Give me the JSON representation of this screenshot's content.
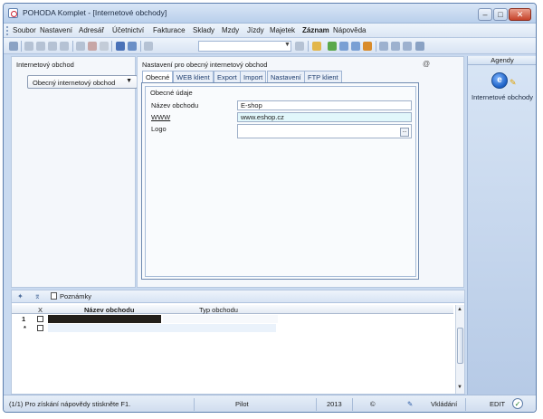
{
  "window": {
    "title": "POHODA Komplet - [Internetové obchody]",
    "buttons": {
      "minimize": "–",
      "maximize": "□",
      "close": "✕"
    }
  },
  "menu": {
    "items": [
      {
        "label": "Soubor",
        "bold": false
      },
      {
        "label": "Nastavení",
        "bold": false
      },
      {
        "label": "Adresář",
        "bold": false
      },
      {
        "label": "Účetnictví",
        "bold": false
      },
      {
        "label": "Fakturace",
        "bold": false
      },
      {
        "label": "Sklady",
        "bold": false
      },
      {
        "label": "Mzdy",
        "bold": false
      },
      {
        "label": "Jízdy",
        "bold": false
      },
      {
        "label": "Majetek",
        "bold": false
      },
      {
        "label": "Záznam",
        "bold": true
      },
      {
        "label": "Nápověda",
        "bold": false
      }
    ]
  },
  "toolbar": {
    "icons": [
      "print-icon",
      "copy-icon",
      "find-icon",
      "new-record-icon",
      "delete-icon",
      "save-icon",
      "filter-icon",
      "agenda-icon",
      "calendar-icon",
      "contacts-icon",
      "help-icon"
    ]
  },
  "left_panel": {
    "label": "Internetový obchod",
    "combo_value": "Obecný internetový obchod"
  },
  "settings": {
    "label": "Nastavení pro obecný internetový obchod",
    "help": "@",
    "tabs": [
      {
        "label": "Obecné",
        "active": true
      },
      {
        "label": "WEB klient",
        "active": false
      },
      {
        "label": "Export",
        "active": false
      },
      {
        "label": "Import",
        "active": false
      },
      {
        "label": "Nastavení",
        "active": false
      },
      {
        "label": "FTP klient",
        "active": false
      }
    ],
    "group_label": "Obecné údaje",
    "fields": {
      "name_label": "Název obchodu",
      "name_value": "E-shop",
      "www_label": "WWW",
      "www_value": "www.eshop.cz",
      "logo_label": "Logo",
      "logo_button": "..."
    }
  },
  "agenda": {
    "header": "Agendy",
    "item_label": "Internetové obchody",
    "item_icon": "internet-store-icon"
  },
  "bottom": {
    "pin": "✦",
    "filter": "⌆",
    "notes_label": "Poznámky",
    "columns": {
      "x": "X",
      "name": "Název obchodu",
      "type": "Typ obchodu"
    },
    "rows": [
      {
        "num": "1",
        "name": "",
        "type": ""
      },
      {
        "num": "*",
        "name": "",
        "type": ""
      }
    ]
  },
  "status": {
    "help_text": "(1/1) Pro získání nápovědy stiskněte F1.",
    "user": "Pilot",
    "year": "2013",
    "mode_symbol": "©",
    "pen": "✎",
    "state": "Vkládání",
    "edit": "EDIT",
    "check": "✓"
  },
  "colors": {
    "window_bg": "#c9daf0",
    "row_selected": "#231f1a",
    "input_cyan": "#e1f7fb"
  }
}
